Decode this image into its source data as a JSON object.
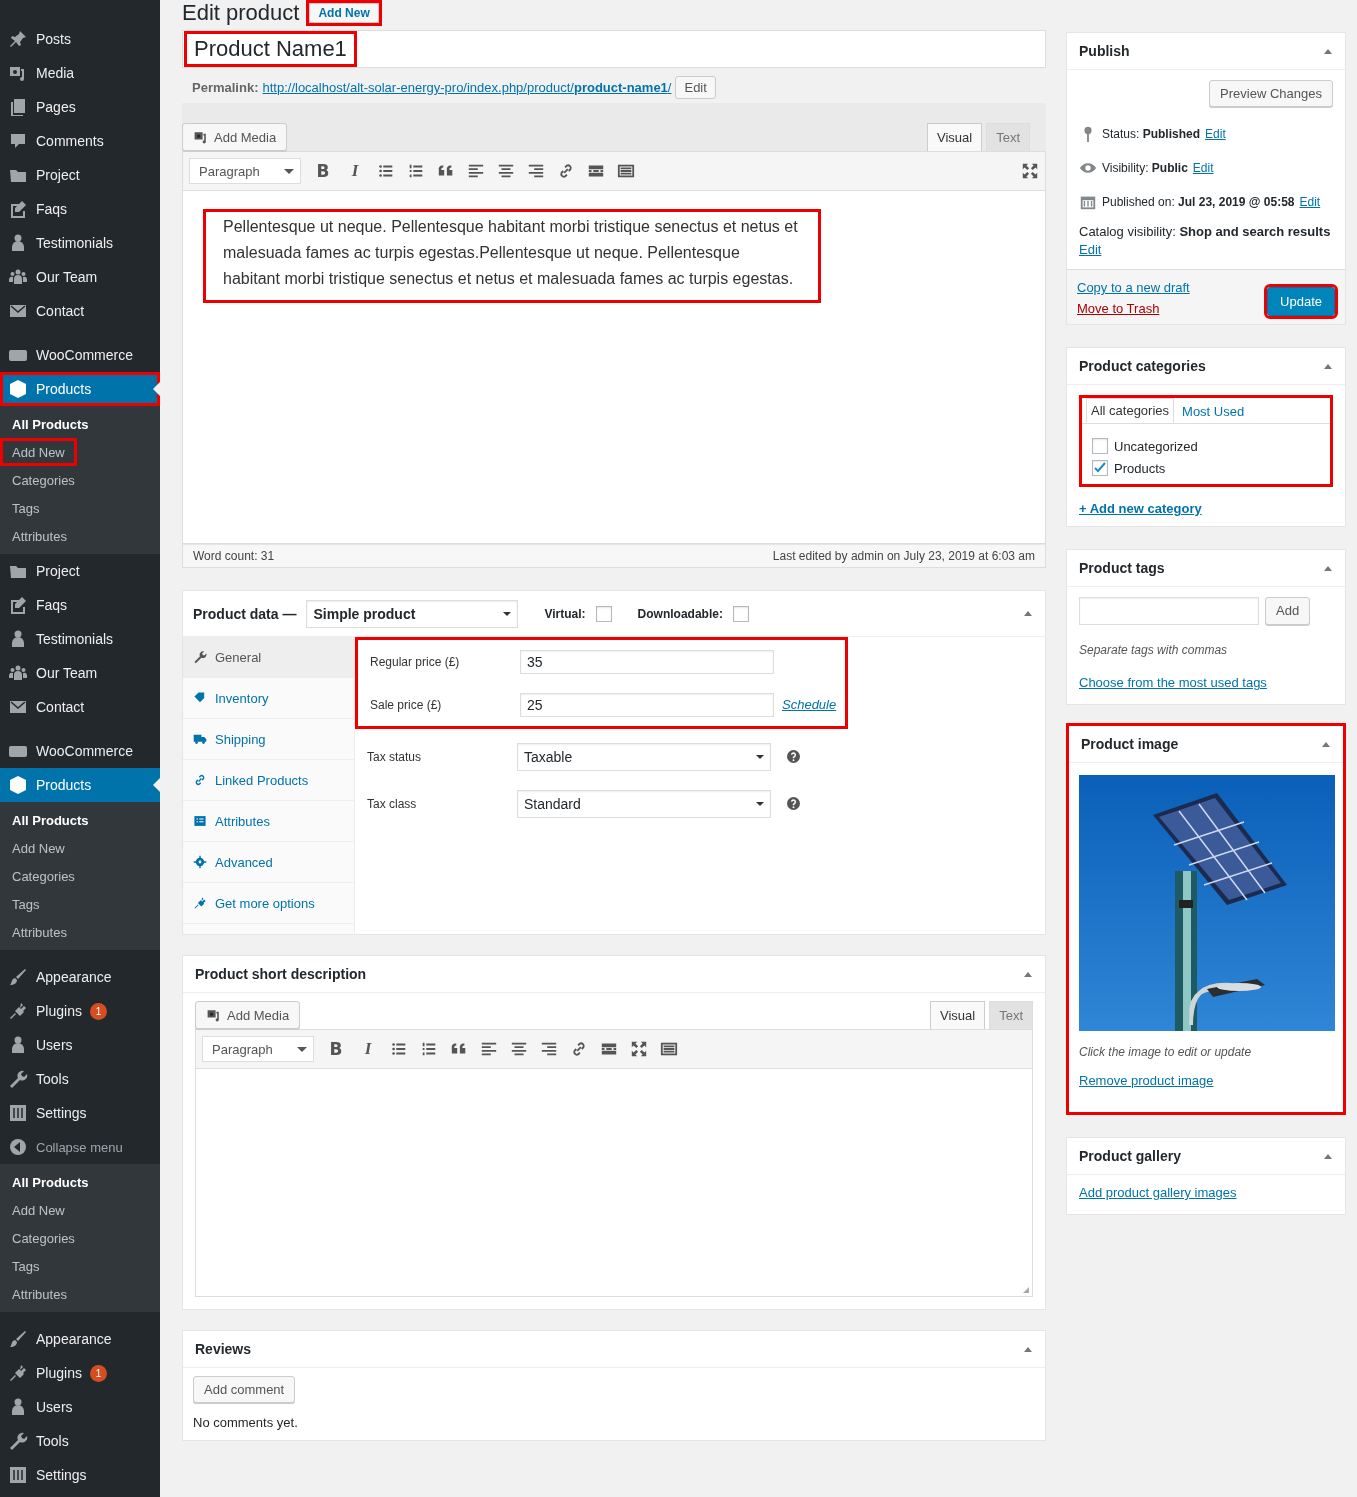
{
  "sidebar": {
    "sections": [
      {
        "items": [
          {
            "kind": "menu",
            "label": "Posts",
            "selected": false,
            "annotated": false
          },
          {
            "kind": "menu",
            "label": "Media",
            "selected": false,
            "annotated": false
          },
          {
            "kind": "menu",
            "label": "Pages",
            "selected": false,
            "annotated": false
          },
          {
            "kind": "menu",
            "label": "Comments",
            "selected": false,
            "annotated": false
          },
          {
            "kind": "menu",
            "label": "Project",
            "selected": false,
            "annotated": false
          },
          {
            "kind": "menu",
            "label": "Faqs",
            "selected": false,
            "annotated": false
          },
          {
            "kind": "menu",
            "label": "Testimonials",
            "selected": false,
            "annotated": false
          },
          {
            "kind": "menu",
            "label": "Our Team",
            "selected": false,
            "annotated": false
          },
          {
            "kind": "menu",
            "label": "Contact",
            "selected": false,
            "annotated": false
          }
        ]
      },
      {
        "items": [
          {
            "kind": "menu",
            "label": "WooCommerce",
            "selected": false,
            "annotated": false
          },
          {
            "kind": "menu",
            "label": "Products",
            "selected": true,
            "annotated": true
          },
          {
            "kind": "sub",
            "label": "All Products",
            "selected": true,
            "annotated": false
          },
          {
            "kind": "sub",
            "label": "Add New",
            "selected": false,
            "annotated": true
          },
          {
            "kind": "sub",
            "label": "Categories",
            "selected": false,
            "annotated": false
          },
          {
            "kind": "sub",
            "label": "Tags",
            "selected": false,
            "annotated": false
          },
          {
            "kind": "sub",
            "label": "Attributes",
            "selected": false,
            "annotated": false
          },
          {
            "kind": "menu",
            "label": "Project",
            "selected": false,
            "annotated": false
          },
          {
            "kind": "menu",
            "label": "Faqs",
            "selected": false,
            "annotated": false
          },
          {
            "kind": "menu",
            "label": "Testimonials",
            "selected": false,
            "annotated": false
          },
          {
            "kind": "menu",
            "label": "Our Team",
            "selected": false,
            "annotated": false
          },
          {
            "kind": "menu",
            "label": "Contact",
            "selected": false,
            "annotated": false
          }
        ]
      },
      {
        "items": [
          {
            "kind": "menu",
            "label": "WooCommerce",
            "selected": false,
            "annotated": false
          },
          {
            "kind": "menu",
            "label": "Products",
            "selected": true,
            "annotated": false
          },
          {
            "kind": "sub",
            "label": "All Products",
            "selected": true,
            "annotated": false
          },
          {
            "kind": "sub",
            "label": "Add New",
            "selected": false,
            "annotated": false
          },
          {
            "kind": "sub",
            "label": "Categories",
            "selected": false,
            "annotated": false
          },
          {
            "kind": "sub",
            "label": "Tags",
            "selected": false,
            "annotated": false
          },
          {
            "kind": "sub",
            "label": "Attributes",
            "selected": false,
            "annotated": false
          }
        ]
      },
      {
        "items": [
          {
            "kind": "menu",
            "label": "Appearance",
            "selected": false,
            "annotated": false
          },
          {
            "kind": "menu",
            "label": "Plugins",
            "badge": "1",
            "selected": false,
            "annotated": false
          },
          {
            "kind": "menu",
            "label": "Users",
            "selected": false,
            "annotated": false
          },
          {
            "kind": "menu",
            "label": "Tools",
            "selected": false,
            "annotated": false
          },
          {
            "kind": "menu",
            "label": "Settings",
            "selected": false,
            "annotated": false
          },
          {
            "kind": "collapse",
            "label": "Collapse menu",
            "selected": false,
            "annotated": false
          },
          {
            "kind": "sub",
            "label": "All Products",
            "selected": true,
            "annotated": false
          },
          {
            "kind": "sub",
            "label": "Add New",
            "selected": false,
            "annotated": false
          },
          {
            "kind": "sub",
            "label": "Categories",
            "selected": false,
            "annotated": false
          },
          {
            "kind": "sub",
            "label": "Tags",
            "selected": false,
            "annotated": false
          },
          {
            "kind": "sub",
            "label": "Attributes",
            "selected": false,
            "annotated": false
          }
        ]
      },
      {
        "items": [
          {
            "kind": "menu",
            "label": "Appearance",
            "selected": false,
            "annotated": false
          },
          {
            "kind": "menu",
            "label": "Plugins",
            "badge": "1",
            "selected": false,
            "annotated": false
          },
          {
            "kind": "menu",
            "label": "Users",
            "selected": false,
            "annotated": false
          },
          {
            "kind": "menu",
            "label": "Tools",
            "selected": false,
            "annotated": false
          },
          {
            "kind": "menu",
            "label": "Settings",
            "selected": false,
            "annotated": false
          }
        ]
      }
    ]
  },
  "page": {
    "title": "Edit product",
    "add_new": {
      "label": "Add New",
      "annotated": true
    }
  },
  "post": {
    "title": "Product Name1",
    "title_annotated": true,
    "permalink_label": "Permalink:",
    "permalink": "http://localhost/alt-solar-energy-pro/index.php/product/**product-name1**/",
    "permalink_edit": "Edit"
  },
  "editor": {
    "add_media": "Add Media",
    "tabs": [
      {
        "label": "Visual",
        "selected": true
      },
      {
        "label": "Text",
        "selected": false
      }
    ],
    "toolbar": {
      "format": "Paragraph",
      "buttons": [
        {
          "kind": "bold",
          "label": "B"
        },
        {
          "kind": "italic",
          "label": "I"
        },
        {
          "kind": "bullets"
        },
        {
          "kind": "numbers"
        },
        {
          "kind": "quote"
        },
        {
          "kind": "align-left"
        },
        {
          "kind": "align-center"
        },
        {
          "kind": "align-right"
        },
        {
          "kind": "link"
        },
        {
          "kind": "more"
        },
        {
          "kind": "kitchen"
        }
      ],
      "end_buttons": [
        {
          "kind": "fullscreen"
        }
      ]
    },
    "content": "Pellentesque ut neque. Pellentesque habitant morbi tristique senectus et netus et malesuada fames ac turpis egestas.Pellentesque ut neque. Pellentesque habitant morbi tristique senectus et netus et malesuada fames ac turpis egestas.",
    "content_annotated": true,
    "word_count": "Word count: 31",
    "last_edited": "Last edited by admin on July 23, 2019 at 6:03 am"
  },
  "product_data": {
    "title": "Product data —",
    "type": "Simple product",
    "virtual_label": "Virtual:",
    "virtual": false,
    "downloadable_label": "Downloadable:",
    "downloadable": false,
    "tabs": [
      {
        "label": "General",
        "selected": true
      },
      {
        "label": "Inventory",
        "selected": false
      },
      {
        "label": "Shipping",
        "selected": false
      },
      {
        "label": "Linked Products",
        "selected": false
      },
      {
        "label": "Attributes",
        "selected": false
      },
      {
        "label": "Advanced",
        "selected": false
      },
      {
        "label": "Get more options",
        "selected": false
      }
    ],
    "price_annotated": true,
    "regular_price_label": "Regular price (£)",
    "regular_price": "35",
    "sale_price_label": "Sale price (£)",
    "sale_price": "25",
    "schedule": "Schedule",
    "tax_status_label": "Tax status",
    "tax_status": "Taxable",
    "tax_class_label": "Tax class",
    "tax_class": "Standard"
  },
  "short_description": {
    "title": "Product short description",
    "add_media": "Add Media",
    "tabs": [
      {
        "label": "Visual",
        "selected": true
      },
      {
        "label": "Text",
        "selected": false
      }
    ],
    "toolbar": {
      "format": "Paragraph",
      "buttons": [
        {
          "kind": "bold",
          "label": "B"
        },
        {
          "kind": "italic",
          "label": "I"
        },
        {
          "kind": "bullets"
        },
        {
          "kind": "numbers"
        },
        {
          "kind": "quote"
        },
        {
          "kind": "align-left"
        },
        {
          "kind": "align-center"
        },
        {
          "kind": "align-right"
        },
        {
          "kind": "link"
        },
        {
          "kind": "more"
        },
        {
          "kind": "fullscreen"
        },
        {
          "kind": "kitchen"
        }
      ]
    }
  },
  "reviews": {
    "title": "Reviews",
    "add_comment": "Add comment",
    "empty": "No comments yet."
  },
  "publish": {
    "title": "Publish",
    "preview": "Preview Changes",
    "rows": [
      {
        "kind": "status",
        "text": "Status: **Published**",
        "edit": "Edit"
      },
      {
        "kind": "visibility",
        "text": "Visibility: **Public**",
        "edit": "Edit"
      },
      {
        "kind": "date",
        "text": "Published on: **Jul 23, 2019 @ 05:58**",
        "edit": "Edit"
      }
    ],
    "catalog": "Catalog visibility: **Shop and search results**",
    "catalog_edit": "Edit",
    "copy": "Copy to a new draft",
    "trash": "Move to Trash",
    "update": "Update",
    "update_annotated": true
  },
  "categories": {
    "title": "Product categories",
    "annotated": true,
    "tabs": [
      {
        "label": "All categories",
        "selected": true
      },
      {
        "label": "Most Used",
        "selected": false
      }
    ],
    "items": [
      {
        "label": "Uncategorized",
        "checked": false
      },
      {
        "label": "Products",
        "checked": true
      }
    ],
    "add": "+ Add new category"
  },
  "tags": {
    "title": "Product tags",
    "add": "Add",
    "hint": "Separate tags with commas",
    "choose": "Choose from the most used tags"
  },
  "image": {
    "title": "Product image",
    "annotated": true,
    "hint": "Click the image to edit or update",
    "remove": "Remove product image"
  },
  "gallery": {
    "title": "Product gallery",
    "add": "Add product gallery images"
  }
}
